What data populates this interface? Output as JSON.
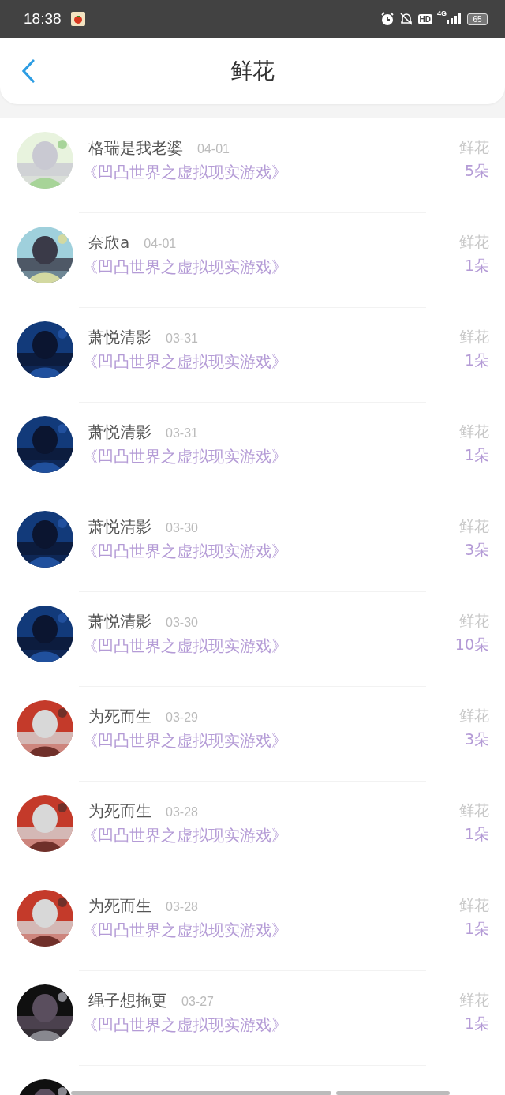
{
  "status_bar": {
    "time": "18:38",
    "battery": "65",
    "network": "4G",
    "hd": "HD"
  },
  "header": {
    "title": "鲜花"
  },
  "rows": [
    {
      "name": "格瑞是我老婆",
      "date": "04-01",
      "book": "《凹凸世界之虚拟现实游戏》",
      "label": "鲜花",
      "count": "5朵"
    },
    {
      "name": "奈欣a",
      "date": "04-01",
      "book": "《凹凸世界之虚拟现实游戏》",
      "label": "鲜花",
      "count": "1朵"
    },
    {
      "name": "萧悦清影",
      "date": "03-31",
      "book": "《凹凸世界之虚拟现实游戏》",
      "label": "鲜花",
      "count": "1朵"
    },
    {
      "name": "萧悦清影",
      "date": "03-31",
      "book": "《凹凸世界之虚拟现实游戏》",
      "label": "鲜花",
      "count": "1朵"
    },
    {
      "name": "萧悦清影",
      "date": "03-30",
      "book": "《凹凸世界之虚拟现实游戏》",
      "label": "鲜花",
      "count": "3朵"
    },
    {
      "name": "萧悦清影",
      "date": "03-30",
      "book": "《凹凸世界之虚拟现实游戏》",
      "label": "鲜花",
      "count": "10朵"
    },
    {
      "name": "为死而生",
      "date": "03-29",
      "book": "《凹凸世界之虚拟现实游戏》",
      "label": "鲜花",
      "count": "3朵"
    },
    {
      "name": "为死而生",
      "date": "03-28",
      "book": "《凹凸世界之虚拟现实游戏》",
      "label": "鲜花",
      "count": "1朵"
    },
    {
      "name": "为死而生",
      "date": "03-28",
      "book": "《凹凸世界之虚拟现实游戏》",
      "label": "鲜花",
      "count": "1朵"
    },
    {
      "name": "绳子想拖更",
      "date": "03-27",
      "book": "《凹凸世界之虚拟现实游戏》",
      "label": "鲜花",
      "count": "1朵"
    }
  ]
}
